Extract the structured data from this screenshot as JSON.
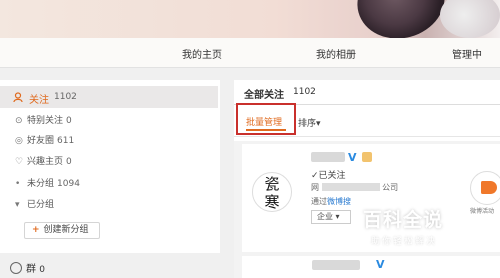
{
  "nav": {
    "home": "我的主页",
    "album": "我的相册",
    "manage": "管理中"
  },
  "sidebar": {
    "follow_label": "关注",
    "follow_count": "1102",
    "items": [
      {
        "icon": "star-icon",
        "label": "特别关注",
        "count": "0"
      },
      {
        "icon": "friends-icon",
        "label": "好友圈",
        "count": "611"
      },
      {
        "icon": "heart-icon",
        "label": "兴趣主页",
        "count": "0"
      },
      {
        "icon": "dot-icon",
        "label": "未分组",
        "count": "1094"
      },
      {
        "icon": "triangle-down-icon",
        "label": "已分组",
        "count": ""
      }
    ],
    "new_group": "创建新分组",
    "group_label": "群",
    "group_count": "0"
  },
  "main": {
    "all_follows": "全部关注",
    "all_follows_count": "1102",
    "batch": "批量管理",
    "sort": "排序"
  },
  "card": {
    "avatar_text": "瓷\n寒",
    "verify": "V",
    "followed": "已关注",
    "company_prefix": "网",
    "company_suffix": "公司",
    "via_prefix": "通过",
    "via_link": "微博搜",
    "enterprise": "企业",
    "badge_caption": "微博活动"
  },
  "watermark": {
    "title": "百科全说",
    "subtitle": "助你轻松解决"
  },
  "colors": {
    "accent": "#e06a1e",
    "highlight_border": "#c9302c",
    "link": "#2a7bd1",
    "verify": "#2a8ae0"
  }
}
